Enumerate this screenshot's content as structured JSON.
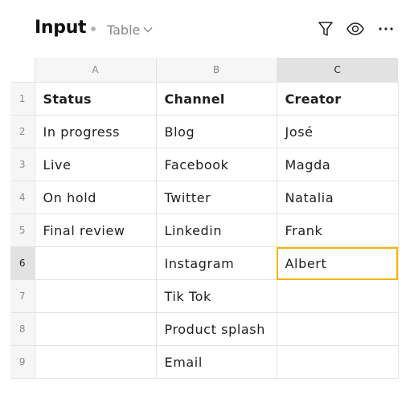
{
  "header": {
    "title": "Input",
    "view_label": "Table",
    "icons": [
      "filter-icon",
      "eye-icon",
      "more-icon"
    ]
  },
  "columns": [
    {
      "letter": "A",
      "selected": false
    },
    {
      "letter": "B",
      "selected": false
    },
    {
      "letter": "C",
      "selected": true
    }
  ],
  "rows": [
    {
      "num": "1",
      "cells": [
        "Status",
        "Channel",
        "Creator"
      ]
    },
    {
      "num": "2",
      "cells": [
        "In progress",
        "Blog",
        "José"
      ]
    },
    {
      "num": "3",
      "cells": [
        "Live",
        "Facebook",
        "Magda"
      ]
    },
    {
      "num": "4",
      "cells": [
        "On hold",
        "Twitter",
        "Natalia"
      ]
    },
    {
      "num": "5",
      "cells": [
        "Final review",
        "Linkedin",
        "Frank"
      ]
    },
    {
      "num": "6",
      "cells": [
        "",
        "Instagram",
        "Albert"
      ]
    },
    {
      "num": "7",
      "cells": [
        "",
        "Tik Tok",
        ""
      ]
    },
    {
      "num": "8",
      "cells": [
        "",
        "Product splash",
        ""
      ]
    },
    {
      "num": "9",
      "cells": [
        "",
        "Email",
        ""
      ]
    }
  ],
  "selection": {
    "row": "6",
    "column": "C"
  },
  "colors": {
    "selection_border": "#f7b500",
    "selected_header": "#e2e2e2",
    "header_bg": "#f6f6f6"
  }
}
